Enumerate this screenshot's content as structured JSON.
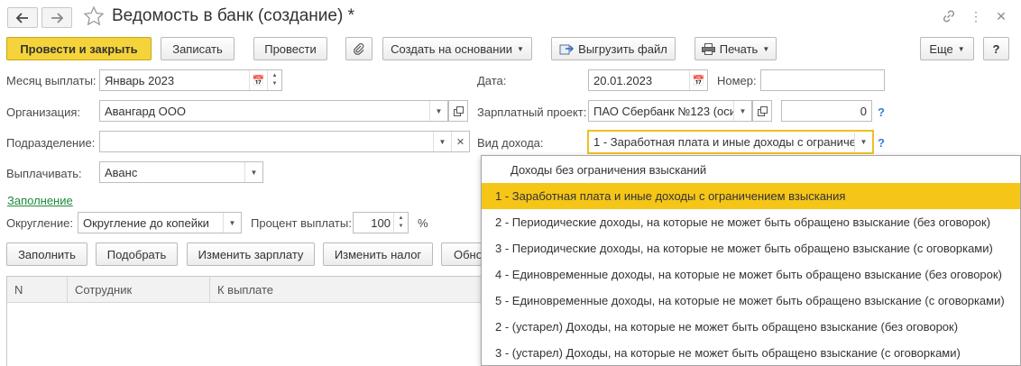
{
  "window": {
    "title": "Ведомость в банк (создание) *"
  },
  "toolbar": {
    "post_close": "Провести и закрыть",
    "save": "Записать",
    "post": "Провести",
    "create_based": "Создать на основании",
    "export": "Выгрузить файл",
    "print": "Печать",
    "more": "Еще",
    "help": "?"
  },
  "form": {
    "month_label": "Месяц выплаты:",
    "month_value": "Январь 2023",
    "date_label": "Дата:",
    "date_value": "20.01.2023",
    "number_label": "Номер:",
    "number_value": "",
    "org_label": "Организация:",
    "org_value": "Авангард ООО",
    "salary_project_label": "Зарплатный проект:",
    "salary_project_value": "ПАО Сбербанк №123 (оси",
    "salary_project_amount": "0",
    "department_label": "Подразделение:",
    "department_value": "",
    "income_type_label": "Вид дохода:",
    "income_type_value": "1 - Заработная плата и иные доходы с ограниче",
    "pay_label": "Выплачивать:",
    "pay_value": "Аванс",
    "fill_link": "Заполнение",
    "rounding_label": "Округление:",
    "rounding_value": "Округление до копейки",
    "percent_label": "Процент выплаты:",
    "percent_value": "100",
    "percent_unit": "%",
    "help_mark": "?"
  },
  "table_toolbar": {
    "fill": "Заполнить",
    "pick": "Подобрать",
    "change_salary": "Изменить зарплату",
    "change_tax": "Изменить налог",
    "refresh": "Обно"
  },
  "table": {
    "columns": [
      "N",
      "Сотрудник",
      "К выплате"
    ]
  },
  "dropdown": {
    "selected_index": 1,
    "items": [
      "Доходы без ограничения взысканий",
      "1 - Заработная плата и иные доходы с ограничением взыскания",
      "2 - Периодические доходы, на которые не может быть обращено взыскание (без оговорок)",
      "3 - Периодические доходы, на которые не может быть обращено взыскание (с оговорками)",
      "4 - Единовременные доходы, на которые не может быть обращено взыскание (без оговорок)",
      "5 - Единовременные доходы, на которые не может быть обращено взыскание (с оговорками)",
      "2 - (устарел) Доходы, на которые не может быть обращено взыскание (без оговорок)",
      "3 - (устарел) Доходы, на которые не может быть обращено взыскание (с оговорками)"
    ]
  },
  "colors": {
    "accent": "#f5d33a",
    "selection": "#f5c518",
    "link": "#1e8a3c",
    "help": "#3a7bd5"
  }
}
